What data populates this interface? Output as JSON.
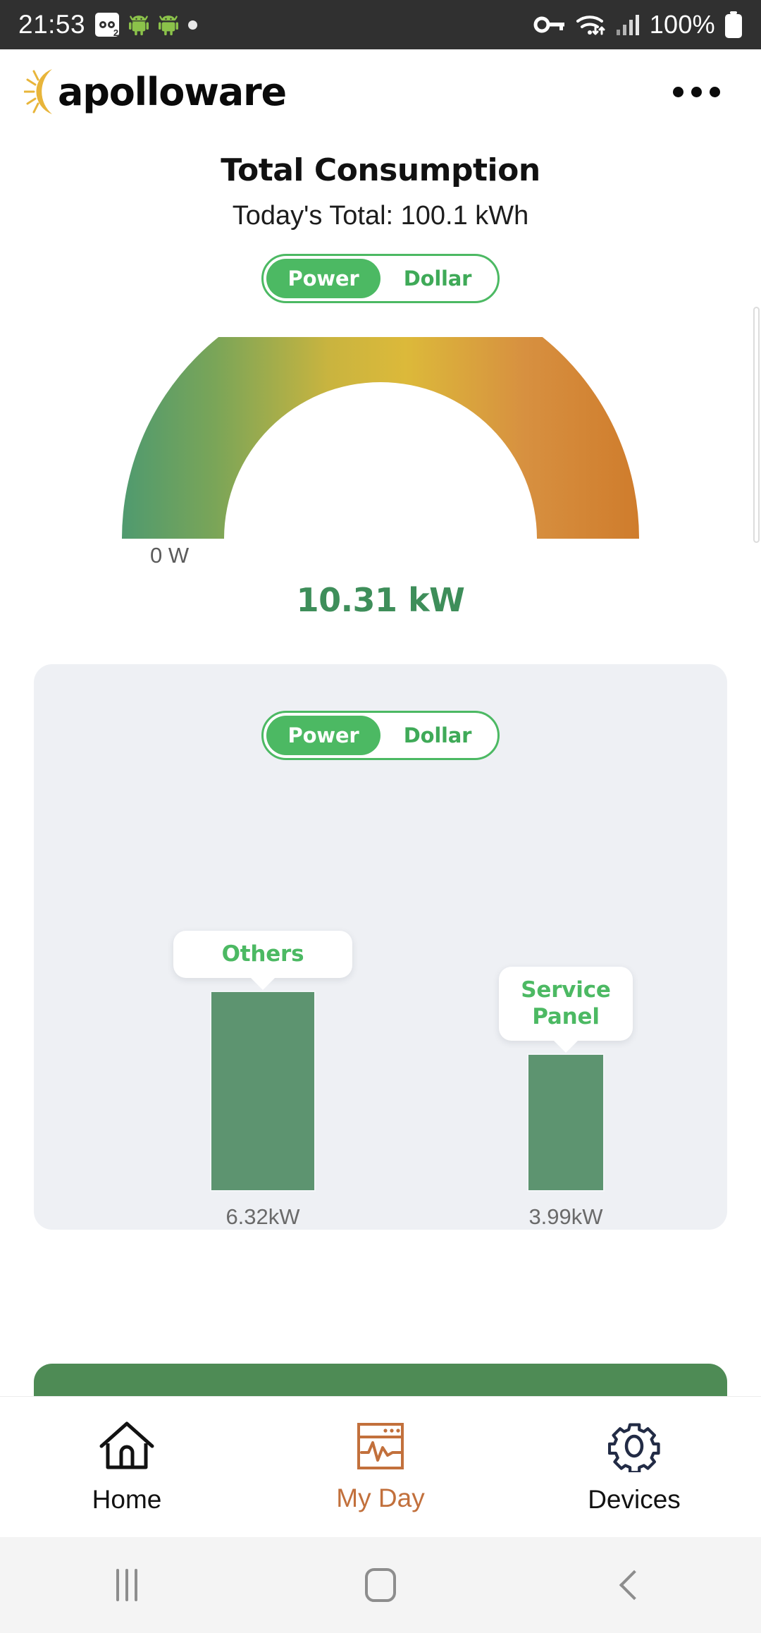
{
  "status_bar": {
    "time": "21:53",
    "battery_percent": "100%",
    "icons": [
      "voicemail-icon",
      "android-icon",
      "android-icon",
      "dot-icon",
      "vpn-key-icon",
      "wifi-icon",
      "signal-icon",
      "battery-icon"
    ],
    "voicemail_badge_count": "2",
    "background": "#303030"
  },
  "app_bar": {
    "brand": "apolloware",
    "brand_accent": "#e8b53a",
    "overflow_menu": "more-options"
  },
  "overview": {
    "title": "Total Consumption",
    "subtitle": "Today's Total: 100.1 kWh",
    "toggle": {
      "options": [
        "Power",
        "Dollar"
      ],
      "selected": "Power",
      "accent": "#4cb963"
    },
    "gauge": {
      "min_label": "0 W",
      "value_label": "10.31 kW",
      "value_color": "#3e8e5a",
      "gradient_start": "#4e9a6b",
      "gradient_mid": "#d9b83c",
      "gradient_end": "#d1802f"
    }
  },
  "breakdown_card": {
    "toggle": {
      "options": [
        "Power",
        "Dollar"
      ],
      "selected": "Power",
      "accent": "#4cb963"
    },
    "background": "#eef0f4"
  },
  "chart_data": {
    "type": "bar",
    "title": "",
    "categories": [
      "Others",
      "Service Panel"
    ],
    "values": [
      6.32,
      3.99
    ],
    "value_labels": [
      "6.32kW",
      "3.99kW"
    ],
    "unit": "kW",
    "bar_color": "#5d9470",
    "label_color": "#4cb963",
    "ylim": [
      0,
      7
    ],
    "xlabel": "",
    "ylabel": "",
    "grid": false,
    "legend": "none"
  },
  "bottom_nav": {
    "items": [
      {
        "label": "Home",
        "icon": "home-icon",
        "active": false,
        "color": "#121212"
      },
      {
        "label": "My Day",
        "icon": "monitor-chart-icon",
        "active": true,
        "color": "#c2703c"
      },
      {
        "label": "Devices",
        "icon": "gear-icon",
        "active": false,
        "color": "#222b45"
      }
    ]
  },
  "system_nav": {
    "recents": "recents-button",
    "home": "home-button",
    "back": "back-button"
  }
}
